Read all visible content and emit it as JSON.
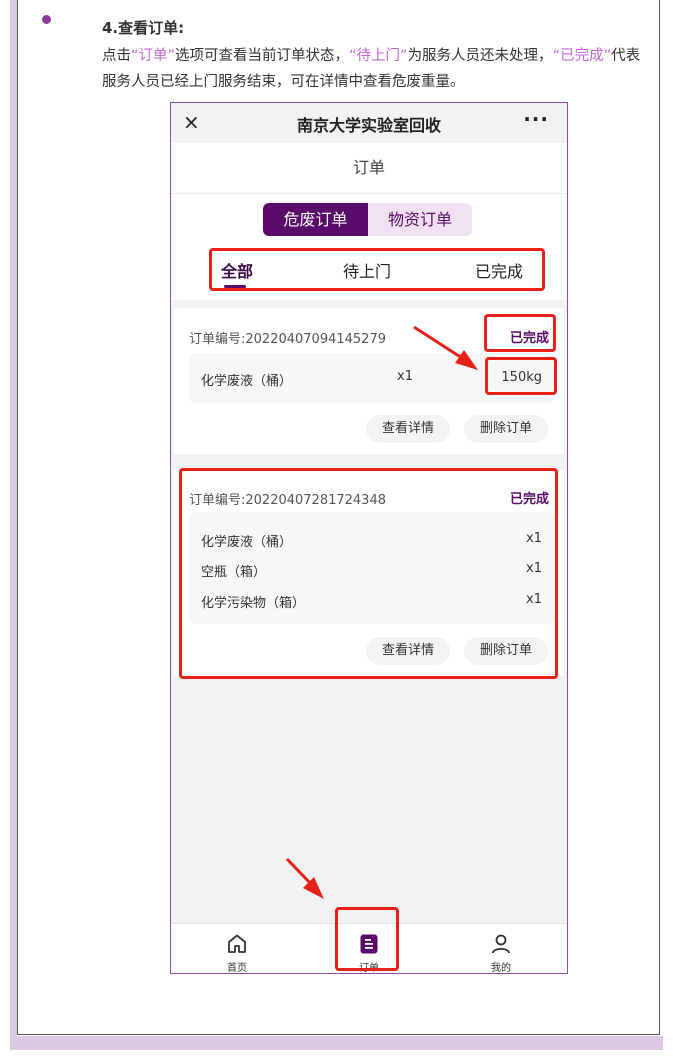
{
  "doc": {
    "heading": "4.查看订单:",
    "para_parts": [
      "点击",
      "“订单”",
      "选项可查看当前订单状态，",
      "“待上门”",
      "为服务人员还未处理，",
      "“已完成”",
      "代表服务人员已经上门服务结束，可在详情中查看危废重量。"
    ]
  },
  "app": {
    "close_icon": "×",
    "title": "南京大学实验室回收",
    "more_icon": "···",
    "page_title": "订单",
    "order_types": [
      "危废订单",
      "物资订单"
    ],
    "status_tabs": [
      "全部",
      "待上门",
      "已完成"
    ],
    "orders": [
      {
        "order_no": "订单编号:20220407094145279",
        "status": "已完成",
        "items": [
          {
            "name": "化学废液（桶）",
            "qty": "x1",
            "weight": "150kg"
          }
        ],
        "buttons": [
          "查看详情",
          "删除订单"
        ]
      },
      {
        "order_no": "订单编号:20220407281724348",
        "status": "已完成",
        "items": [
          {
            "name": "化学废液（桶）",
            "qty": "x1"
          },
          {
            "name": "空瓶（箱）",
            "qty": "x1"
          },
          {
            "name": "化学污染物（箱）",
            "qty": "x1"
          }
        ],
        "buttons": [
          "查看详情",
          "删除订单"
        ]
      }
    ],
    "tabbar": [
      {
        "label": "首页",
        "icon": "home-icon"
      },
      {
        "label": "订单",
        "icon": "order-list-icon"
      },
      {
        "label": "我的",
        "icon": "user-icon"
      }
    ]
  },
  "colors": {
    "accent": "#5a0b6a",
    "highlight": "#c566d6",
    "annotation": "#e8201a"
  }
}
